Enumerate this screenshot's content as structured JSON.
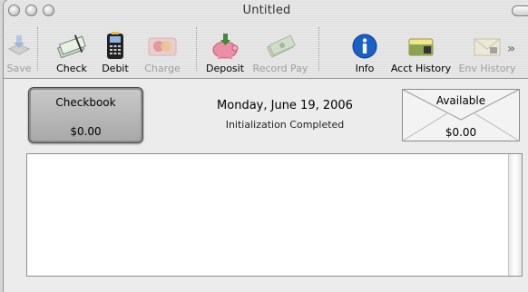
{
  "window": {
    "title": "Untitled"
  },
  "toolbar": {
    "save": "Save",
    "check": "Check",
    "debit": "Debit",
    "charge": "Charge",
    "deposit": "Deposit",
    "record_pay": "Record Pay",
    "info": "Info",
    "acct_history": "Acct History",
    "env_history": "Env History"
  },
  "checkbook": {
    "label": "Checkbook",
    "amount": "$0.00"
  },
  "header": {
    "date": "Monday, June 19, 2006",
    "status": "Initialization Completed"
  },
  "available": {
    "label": "Available",
    "amount": "$0.00"
  },
  "colors": {
    "info_blue": "#1a5fc8",
    "deposit_pig": "#ec8fa4"
  }
}
